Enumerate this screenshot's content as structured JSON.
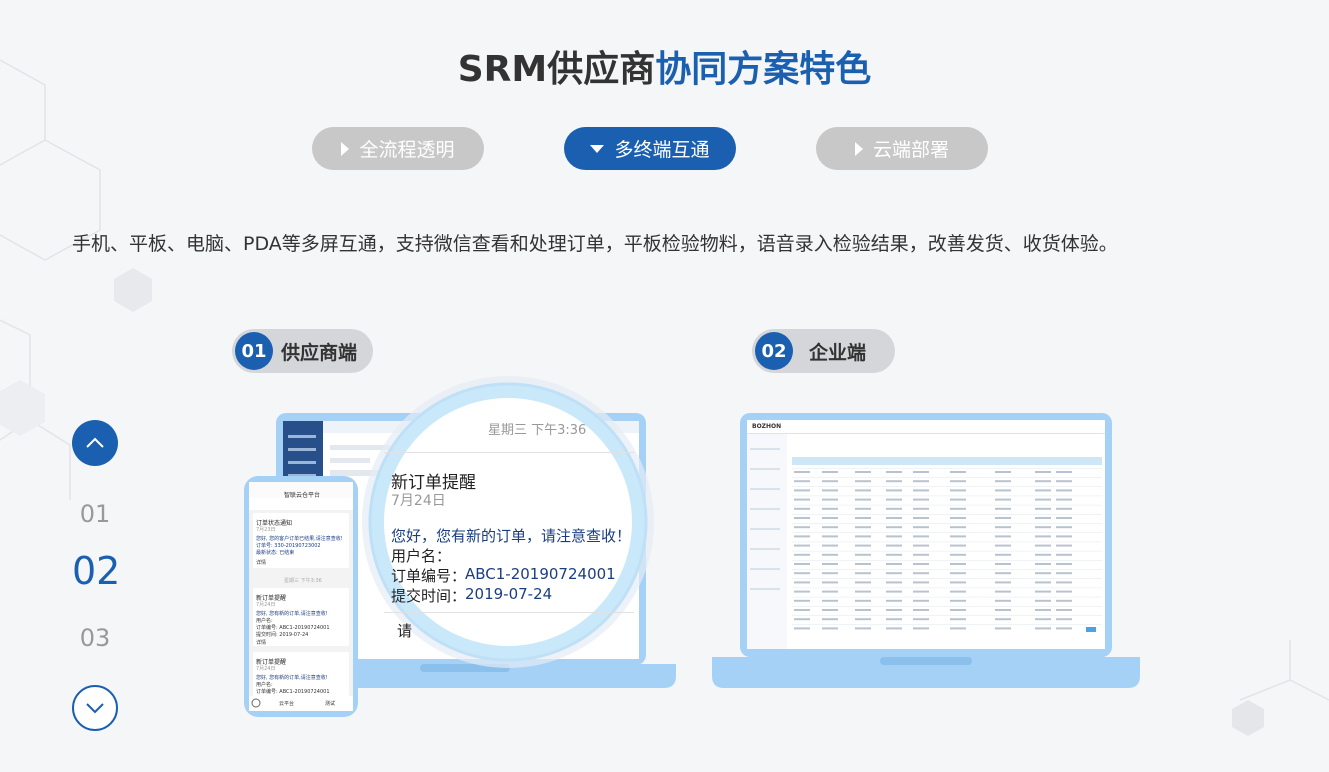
{
  "title": {
    "part1": "SRM供应商",
    "part2": "协同方案特色"
  },
  "tabs": [
    {
      "label": "全流程透明",
      "active": false
    },
    {
      "label": "多终端互通",
      "active": true
    },
    {
      "label": "云端部署",
      "active": false
    }
  ],
  "description": "手机、平板、电脑、PDA等多屏互通，支持微信查看和处理订单，平板检验物料，语音录入检验结果，改善发货、收货体验。",
  "badges": [
    {
      "num": "01",
      "label": "供应商端"
    },
    {
      "num": "02",
      "label": "企业端"
    }
  ],
  "steps": [
    "01",
    "02",
    "03"
  ],
  "magnifier": {
    "datetime": "星期三 下午3:36",
    "heading": "新订单提醒",
    "date": "7月24日",
    "greeting": "您好，您有新的订单，请注意查收！",
    "user_label": "用户名：",
    "order_label": "订单编号：",
    "order_value": "ABC1-20190724001",
    "time_label": "提交时间：",
    "time_value": "2019-07-24",
    "footer_char": "请"
  },
  "phone": {
    "app_title": "智联云仓平台",
    "card1_title": "订单状态通知",
    "card1_date": "7月23日",
    "card1_line1": "您好, 您的客户订单已结果,请注意查收!",
    "card1_line2": "订单号: 330-20190723002",
    "card1_line3": "最新状态: 已结束",
    "card1_detail": "详情",
    "time_divider": "星期三 下午3:36",
    "card2_title": "新订单提醒",
    "card2_date": "7月24日",
    "card2_line1": "您好, 您有新的订单,请注意查收!",
    "card2_line2": "用户名:",
    "card2_line3": "订单编号: ABC1-20190724001",
    "card2_line4": "提交时间: 2019-07-24",
    "card2_detail": "详情",
    "card3_title": "新订单提醒",
    "card3_date": "7月24日",
    "card3_line1": "您好, 您有新的订单,请注意查收!",
    "card3_line2": "用户名:",
    "card3_line3": "订单编号: ABC1-20190724001",
    "bottom_left": "云平台",
    "bottom_right": "测试"
  },
  "enterprise": {
    "logo": "BOZHON"
  },
  "colors": {
    "accent": "#1a5fb0",
    "inactive_tab": "#c8c8c8",
    "laptop_frame": "#a6d1f7"
  }
}
